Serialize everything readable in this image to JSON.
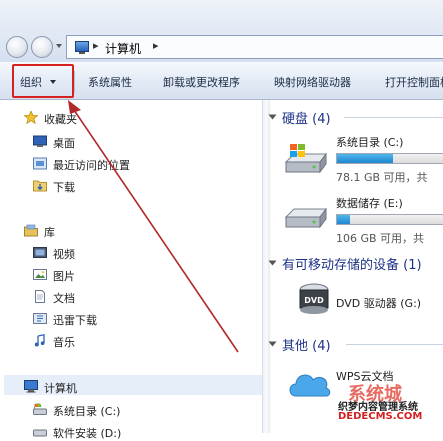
{
  "address_bar": {
    "separator": "▸",
    "path_label": "计算机"
  },
  "toolbar": {
    "organize": "组织",
    "items": [
      "系统属性",
      "卸载或更改程序",
      "映射网络驱动器",
      "打开控制面板"
    ]
  },
  "nav": {
    "favorites": {
      "label": "收藏夹",
      "items": [
        "桌面",
        "最近访问的位置",
        "下载"
      ]
    },
    "libraries": {
      "label": "库",
      "items": [
        "视频",
        "图片",
        "文档",
        "迅雷下载",
        "音乐"
      ]
    },
    "computer": {
      "label": "计算机",
      "items": [
        "系统目录 (C:)",
        "软件安装 (D:)"
      ]
    }
  },
  "content": {
    "hard_disks": {
      "header": "硬盘 (4)",
      "drives": [
        {
          "name": "系统目录 (C:)",
          "used_fraction": 0.52,
          "info": "78.1 GB 可用，共"
        },
        {
          "name": "数据储存 (E:)",
          "used_fraction": 0.12,
          "info": "106 GB 可用，共"
        }
      ]
    },
    "removable": {
      "header": "有可移动存储的设备 (1)",
      "drives": [
        {
          "name": "DVD 驱动器 (G:)",
          "icon_label": "DVD"
        }
      ]
    },
    "other": {
      "header": "其他 (4)",
      "items": [
        {
          "name": "WPS云文档"
        }
      ]
    }
  },
  "watermark": {
    "big": "系统城",
    "line1": "织梦内容管理系统",
    "line2": "DEDECMS.COM"
  },
  "colors": {
    "highlight_box": "#d6211e",
    "annotation_arrow": "#b0282a",
    "group_header": "#1e3287",
    "drive_fill": "#1f87d2"
  }
}
